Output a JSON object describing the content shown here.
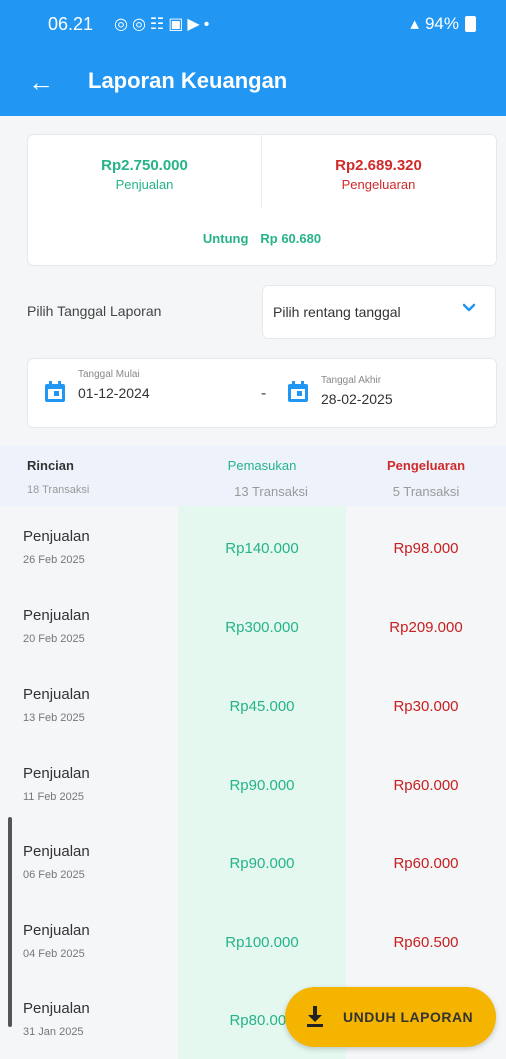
{
  "status_bar": {
    "time": "06.21",
    "icons": "◎◎☷▣▶•",
    "battery": "94%"
  },
  "app_bar": {
    "title": "Laporan Keuangan"
  },
  "summary": {
    "income_value": "Rp2.750.000",
    "income_label": "Penjualan",
    "expense_value": "Rp2.689.320",
    "expense_label": "Pengeluaran",
    "profit_label": "Untung",
    "profit_value": "Rp 60.680"
  },
  "date_filter": {
    "label": "Pilih Tanggal Laporan",
    "range_placeholder": "Pilih rentang tanggal",
    "start_label": "Tanggal Mulai",
    "start_value": "01-12-2024",
    "separator": "-",
    "end_label": "Tanggal Akhir",
    "end_value": "28-02-2025"
  },
  "table_header": {
    "detail": "Rincian",
    "detail_count": "18 Transaksi",
    "income": "Pemasukan",
    "income_count": "13 Transaksi",
    "expense": "Pengeluaran",
    "expense_count": "5 Transaksi"
  },
  "rows": [
    {
      "title": "Penjualan",
      "date": "26 Feb 2025",
      "income": "Rp140.000",
      "expense": "Rp98.000"
    },
    {
      "title": "Penjualan",
      "date": "20 Feb 2025",
      "income": "Rp300.000",
      "expense": "Rp209.000"
    },
    {
      "title": "Penjualan",
      "date": "13 Feb 2025",
      "income": "Rp45.000",
      "expense": "Rp30.000"
    },
    {
      "title": "Penjualan",
      "date": "11 Feb 2025",
      "income": "Rp90.000",
      "expense": "Rp60.000"
    },
    {
      "title": "Penjualan",
      "date": "06 Feb 2025",
      "income": "Rp90.000",
      "expense": "Rp60.000"
    },
    {
      "title": "Penjualan",
      "date": "04 Feb 2025",
      "income": "Rp100.000",
      "expense": "Rp60.500"
    },
    {
      "title": "Penjualan",
      "date": "31 Jan 2025",
      "income": "Rp80.000",
      "expense": ""
    }
  ],
  "fab": {
    "label": "UNDUH LAPORAN"
  },
  "colors": {
    "primary": "#2196f3",
    "income": "#26b38a",
    "expense": "#d02b2b",
    "accent": "#f5b400"
  }
}
